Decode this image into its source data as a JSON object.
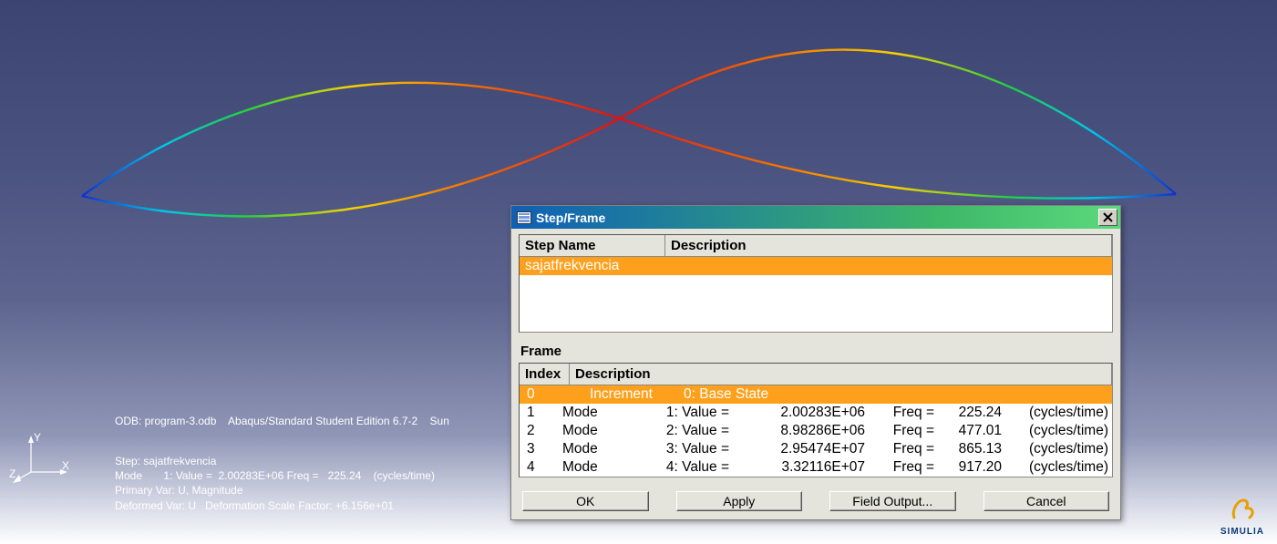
{
  "triad": {
    "x": "X",
    "y": "Y",
    "z": "Z"
  },
  "info": {
    "odb_line": "ODB: program-3.odb    Abaqus/Standard Student Edition 6.7-2    Sun",
    "step_block": "Step: sajatfrekvencia\nMode       1: Value =  2.00283E+06 Freq =   225.24    (cycles/time)\nPrimary Var: U, Magnitude\nDeformed Var: U   Deformation Scale Factor: +6.156e+01"
  },
  "logo": {
    "label": "SIMULIA"
  },
  "dialog": {
    "title": "Step/Frame",
    "step_header_name": "Step Name",
    "step_header_desc": "Description",
    "steps": [
      {
        "name": "sajatfrekvencia",
        "desc": ""
      }
    ],
    "frame_label": "Frame",
    "frame_header_index": "Index",
    "frame_header_desc": "Description",
    "frames": [
      {
        "index": "0",
        "type": "incr",
        "inc_label": "Increment",
        "inc_desc": "0: Base State"
      },
      {
        "index": "1",
        "type": "mode",
        "mode": "Mode",
        "n": "1: Value =",
        "val": "2.00283E+06",
        "freq_lbl": "Freq =",
        "freq": "225.24",
        "unit": "(cycles/time)"
      },
      {
        "index": "2",
        "type": "mode",
        "mode": "Mode",
        "n": "2: Value =",
        "val": "8.98286E+06",
        "freq_lbl": "Freq =",
        "freq": "477.01",
        "unit": "(cycles/time)"
      },
      {
        "index": "3",
        "type": "mode",
        "mode": "Mode",
        "n": "3: Value =",
        "val": "2.95474E+07",
        "freq_lbl": "Freq =",
        "freq": "865.13",
        "unit": "(cycles/time)"
      },
      {
        "index": "4",
        "type": "mode",
        "mode": "Mode",
        "n": "4: Value =",
        "val": "3.32116E+07",
        "freq_lbl": "Freq =",
        "freq": "917.20",
        "unit": "(cycles/time)"
      }
    ],
    "buttons": {
      "ok": "OK",
      "apply": "Apply",
      "field": "Field Output...",
      "cancel": "Cancel"
    }
  }
}
